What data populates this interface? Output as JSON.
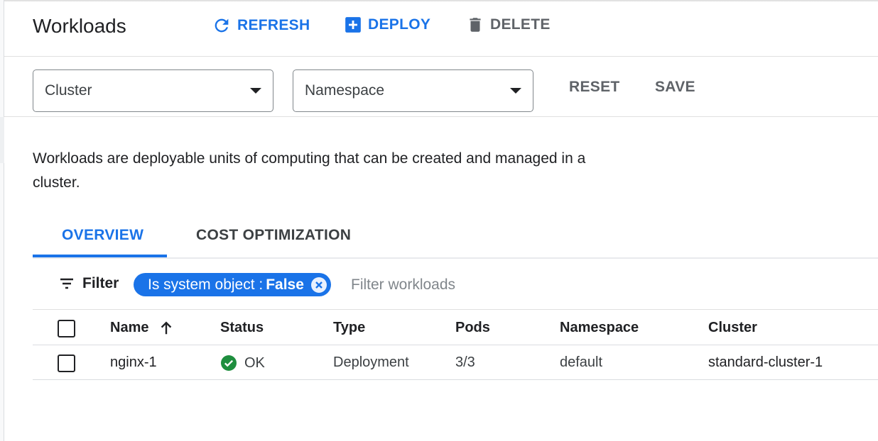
{
  "header": {
    "title": "Workloads",
    "actions": {
      "refresh": "REFRESH",
      "deploy": "DEPLOY",
      "delete": "DELETE"
    }
  },
  "selectors": {
    "cluster": "Cluster",
    "namespace": "Namespace",
    "reset": "RESET",
    "save": "SAVE"
  },
  "description": "Workloads are deployable units of computing that can be created and managed in a cluster.",
  "tabs": [
    {
      "label": "OVERVIEW",
      "active": true
    },
    {
      "label": "COST OPTIMIZATION",
      "active": false
    }
  ],
  "filter": {
    "label": "Filter",
    "chip_key": "Is system object :",
    "chip_value": "False",
    "placeholder": "Filter workloads"
  },
  "table": {
    "columns": [
      "Name",
      "Status",
      "Type",
      "Pods",
      "Namespace",
      "Cluster"
    ],
    "rows": [
      {
        "name": "nginx-1",
        "status": "OK",
        "type": "Deployment",
        "pods": "3/3",
        "namespace": "default",
        "cluster": "standard-cluster-1"
      }
    ]
  },
  "colors": {
    "accent": "#1a73e8",
    "status_ok": "#1e8e3e",
    "muted": "#5f6368"
  }
}
